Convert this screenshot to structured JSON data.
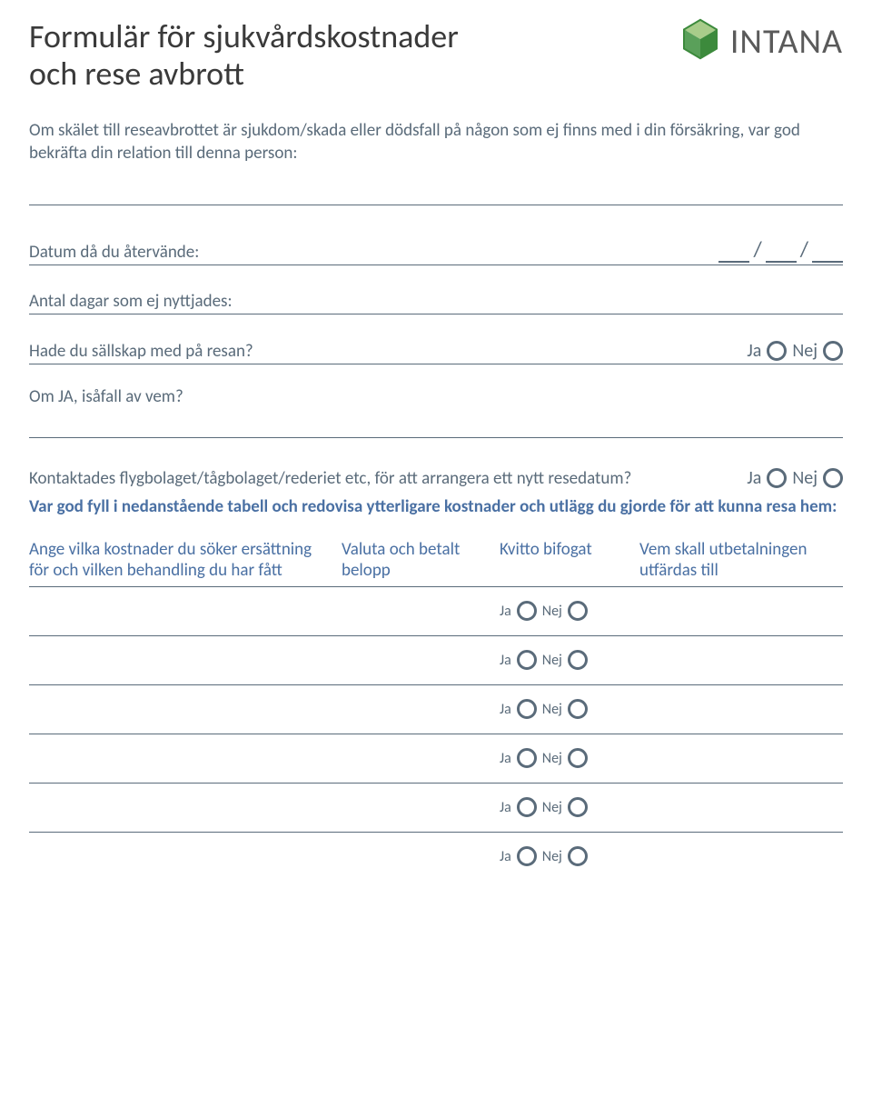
{
  "title_line1": "Formulär för sjukvårdskostnader",
  "title_line2": "och rese avbrott",
  "brand": "INTANA",
  "intro": "Om skälet till reseavbrottet är sjukdom/skada eller dödsfall på någon som ej finns med i din försäkring, var god bekräfta din relation till denna person:",
  "date_return_label": "Datum då du återvände:",
  "days_not_used_label": "Antal dagar som ej nyttjades:",
  "companion_label": "Hade du sällskap med på resan?",
  "if_yes_label": "Om JA, isåfall av vem?",
  "contacted_label": "Kontaktades flygbolaget/tågbolaget/rederiet etc, för att arrangera ett nytt resedatum?",
  "table_instr": "Var god fyll i nedanstående tabell och redovisa ytterligare kostnader och utlägg du gjorde för att kunna resa hem:",
  "ja": "Ja",
  "nej": "Nej",
  "col1": "Ange vilka kostnader du söker ersättning för och vilken behandling du har fått",
  "col2": "Valuta och betalt belopp",
  "col3": "Kvitto bifogat",
  "col4": "Vem skall utbetalningen utfärdas till",
  "date_slash": "/"
}
